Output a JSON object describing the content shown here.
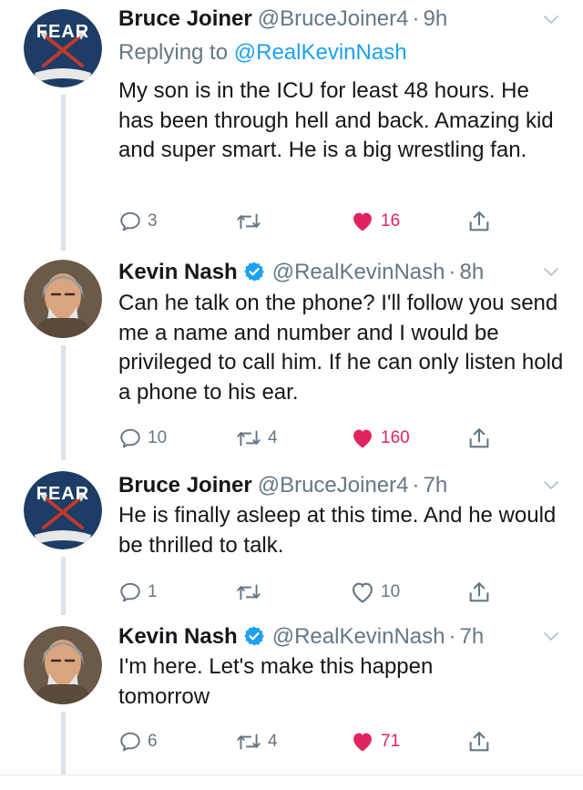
{
  "tweets": [
    {
      "author": "Bruce Joiner",
      "handle": "@BruceJoiner4",
      "time": "9h",
      "avatar_icon": "fear-the-hunt-logo",
      "avatar_text": "FEAR",
      "verified": false,
      "replying_prefix": "Replying to",
      "replying_to": "@RealKevinNash",
      "text": "My son is in the ICU for least 48 hours. He has been through hell and back. Amazing kid and super smart. He is a big wrestling fan.",
      "replies": "3",
      "retweets": "",
      "likes": "16",
      "liked": true
    },
    {
      "author": "Kevin Nash",
      "handle": "@RealKevinNash",
      "time": "8h",
      "avatar_icon": "kevin-nash-portrait",
      "verified": true,
      "text": "Can he talk on the phone?  I'll follow you send me a name and number and I would be privileged to call him. If he can only listen hold a phone to his ear.",
      "replies": "10",
      "retweets": "4",
      "likes": "160",
      "liked": true
    },
    {
      "author": "Bruce Joiner",
      "handle": "@BruceJoiner4",
      "time": "7h",
      "avatar_icon": "fear-the-hunt-logo",
      "avatar_text": "FEAR",
      "verified": false,
      "text": "He is finally asleep at this time. And he would be thrilled to talk.",
      "replies": "1",
      "retweets": "",
      "likes": "10",
      "liked": false
    },
    {
      "author": "Kevin Nash",
      "handle": "@RealKevinNash",
      "time": "7h",
      "avatar_icon": "kevin-nash-portrait",
      "verified": true,
      "text": "I'm here. Let's make this happen tomorrow",
      "replies": "6",
      "retweets": "4",
      "likes": "71",
      "liked": true
    }
  ],
  "colors": {
    "like": "#e0245e",
    "icon": "#657786",
    "link": "#1da1f2",
    "verified": "#1da1f2",
    "thread_line": "#dde2e6"
  }
}
